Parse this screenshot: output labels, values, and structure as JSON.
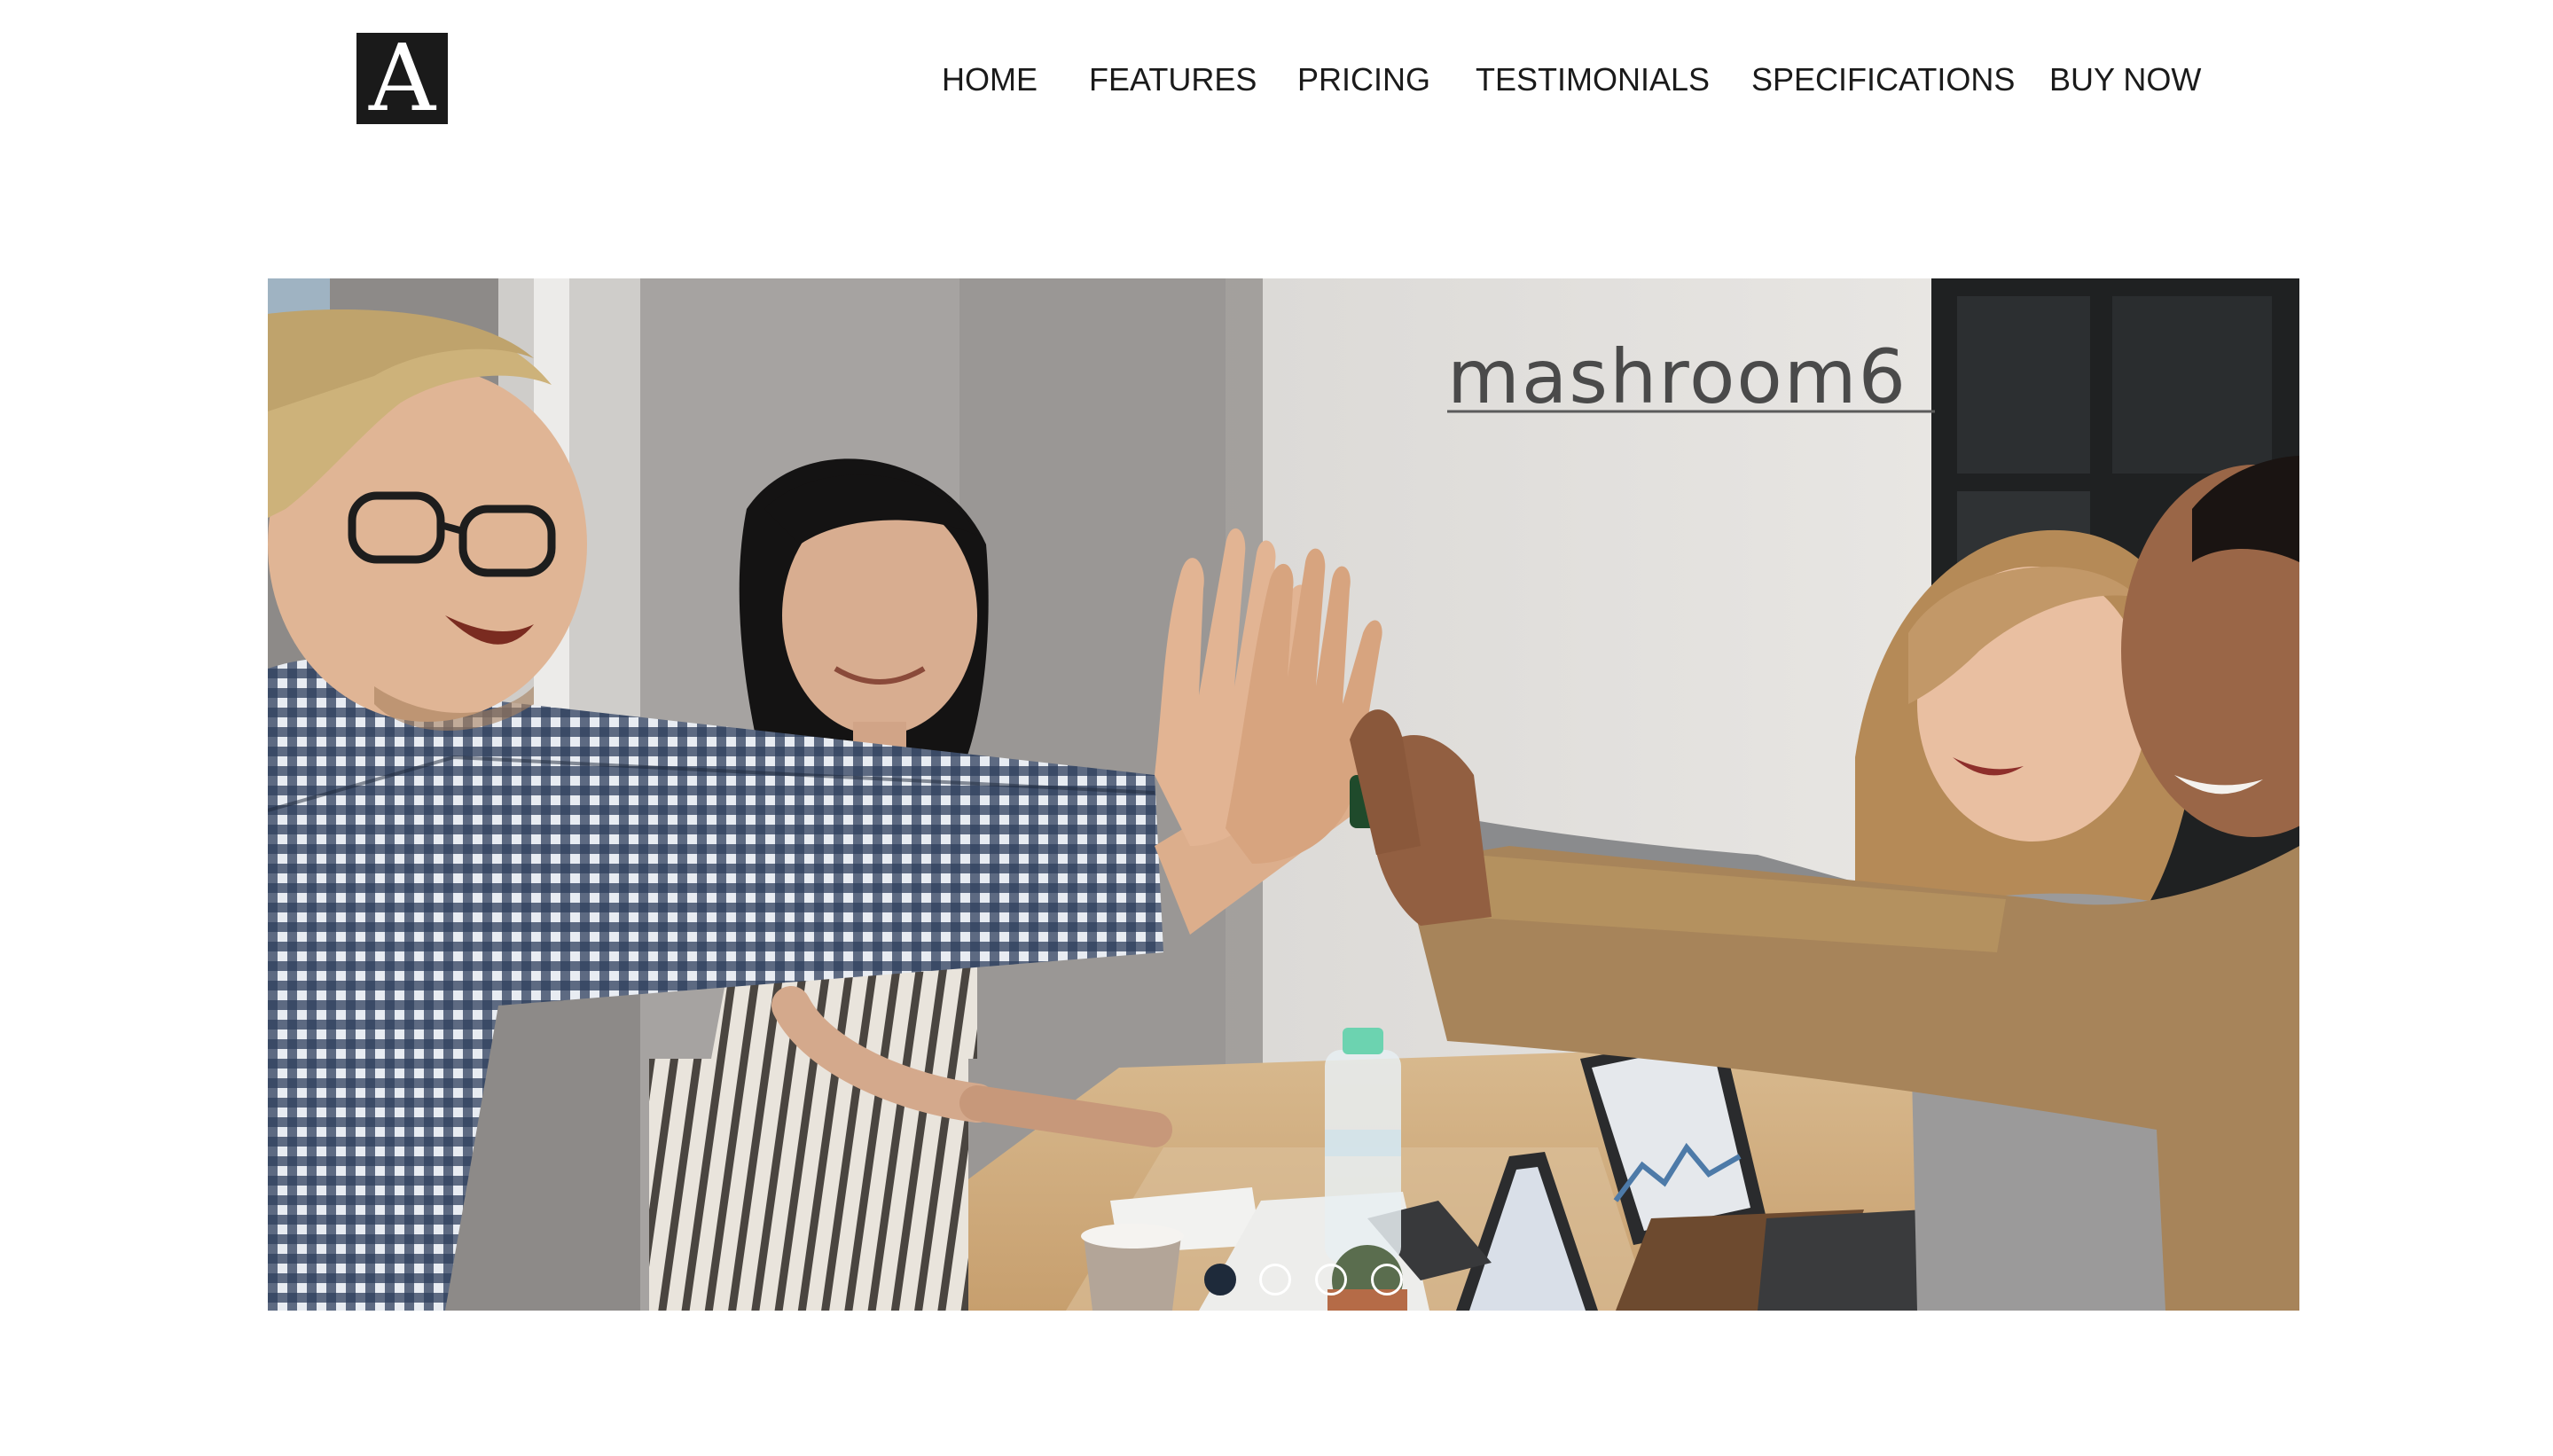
{
  "header": {
    "logo_letter": "A",
    "nav": [
      {
        "label": "HOME"
      },
      {
        "label": "FEATURES"
      },
      {
        "label": "PRICING"
      },
      {
        "label": "TESTIMONIALS"
      },
      {
        "label": "SPECIFICATIONS"
      },
      {
        "label": "BUY NOW"
      }
    ]
  },
  "hero": {
    "sign_text": "mashroom6",
    "slides": [
      {
        "active": true
      },
      {
        "active": false
      },
      {
        "active": false
      },
      {
        "active": false
      }
    ]
  },
  "colors": {
    "nav_text": "#1a1a1a",
    "logo_bg": "#1a1a1a",
    "active_dot": "#1e2a3a"
  }
}
